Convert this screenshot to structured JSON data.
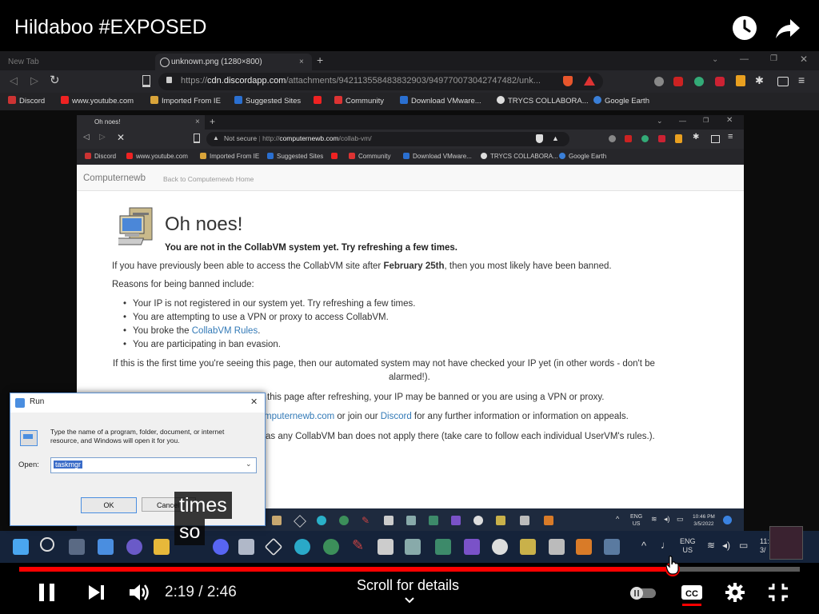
{
  "video": {
    "title": "Hildaboo #EXPOSED",
    "current_time": "2:19",
    "separator": "/",
    "duration": "2:46",
    "progress": 0.8373,
    "scroll_hint": "Scroll for details",
    "captions": [
      "times",
      "so"
    ],
    "accent": "#ff0000"
  },
  "outer_browser": {
    "tabs": [
      {
        "label": "New Tab"
      },
      {
        "label": "unknown.png (1280×800)"
      }
    ],
    "new_tab_symbol": "+",
    "url_scheme": "https://",
    "url_host": "cdn.discordapp.com",
    "url_path": "/attachments/942113558483832903/949770073042747482/unk...",
    "bookmarks": [
      "Discord",
      "www.youtube.com",
      "Imported From IE",
      "Suggested Sites",
      "Community",
      "Download VMware...",
      "TRYCS COLLABORA...",
      "Google Earth"
    ]
  },
  "inner_browser": {
    "tab": "Oh noes!",
    "close_symbol": "×",
    "new_tab_symbol": "+",
    "security": "Not secure",
    "url_scheme": "http://",
    "url_host": "computernewb.com",
    "url_path": "/collab-vm/",
    "bookmarks": [
      "Discord",
      "www.youtube.com",
      "Imported From IE",
      "Suggested Sites",
      "Community",
      "Download VMware...",
      "TRYCS COLLABORA...",
      "Google Earth"
    ]
  },
  "page": {
    "brand": "Computernewb",
    "back_link": "Back to Computernewb Home",
    "heading": "Oh noes!",
    "subheading": "You are not in the CollabVM system yet. Try refreshing a few times.",
    "para1_pre": "If you have previously been able to access the CollabVM site after ",
    "para1_bold": "February 25th",
    "para1_post": ", then you most likely have been banned.",
    "reasons_intro": "Reasons for being banned include:",
    "reasons": [
      "Your IP is not registered in our system yet. Try refreshing a few times.",
      "You are attempting to use a VPN or proxy to access CollabVM.",
      "You broke the ",
      "You are participating in ban evasion."
    ],
    "rules_link": "CollabVM Rules",
    "rules_period": ".",
    "first_time_1": "If this is the first time you're seeing this page, then our automated system may not have checked your IP yet (in other words - don't be",
    "first_time_2": "alarmed!).",
    "continue_text": "this page after refreshing, your IP may be banned or you are using a VPN or proxy.",
    "contact_email": "mputernewb.com",
    "contact_mid": " or join our ",
    "contact_discord": "Discord",
    "contact_post": " for any further information or information on appeals.",
    "userv_text": "as any CollabVM ban does not apply there (take care to follow each individual UserVM's rules.)."
  },
  "run_dialog": {
    "title": "Run",
    "close": "✕",
    "description": "Type the name of a program, folder, document, or internet resource, and Windows will open it for you.",
    "open_label": "Open:",
    "input_value": "taskmgr",
    "ok": "OK",
    "cancel": "Cancel"
  },
  "inner_tray": {
    "lang": "ENG",
    "region": "US",
    "time": "10:46 PM",
    "date": "3/5/2022"
  },
  "outer_tray": {
    "lang": "ENG",
    "region": "US",
    "time": "11:",
    "date": "3/"
  }
}
